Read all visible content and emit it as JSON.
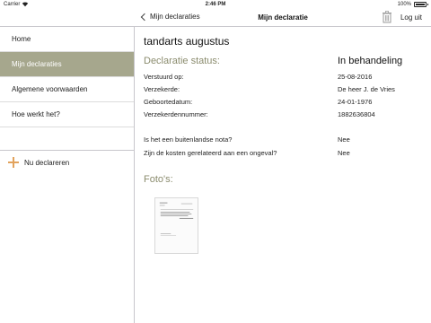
{
  "statusbar": {
    "carrier": "Carrier",
    "time": "2:46 PM",
    "battery": "100%"
  },
  "nav": {
    "back_label": "Mijn declaraties",
    "title": "Mijn declaratie",
    "logout_label": "Log uit"
  },
  "sidebar": {
    "items": [
      {
        "label": "Home"
      },
      {
        "label": "Mijn declaraties"
      },
      {
        "label": "Algemene voorwaarden"
      },
      {
        "label": "Hoe werkt het?"
      }
    ],
    "new_label": "Nu declareren"
  },
  "declaration": {
    "title": "tandarts augustus",
    "status_label": "Declaratie status:",
    "status_value": "In behandeling",
    "fields": [
      {
        "label": "Verstuurd op:",
        "value": "25-08-2016"
      },
      {
        "label": "Verzekerde:",
        "value": "De heer J. de Vries"
      },
      {
        "label": "Geboortedatum:",
        "value": "24-01-1976"
      },
      {
        "label": "Verzekerdennummer:",
        "value": "1882636804"
      }
    ],
    "questions": [
      {
        "label": "Is het een buitenlandse nota?",
        "value": "Nee"
      },
      {
        "label": "Zijn de kosten gerelateerd aan een ongeval?",
        "value": "Nee"
      }
    ],
    "photos_label": "Foto's:"
  },
  "colors": {
    "accent_olive": "#a6a78d",
    "status_green": "#8b8c6e",
    "plus_orange": "#e2a35d"
  }
}
